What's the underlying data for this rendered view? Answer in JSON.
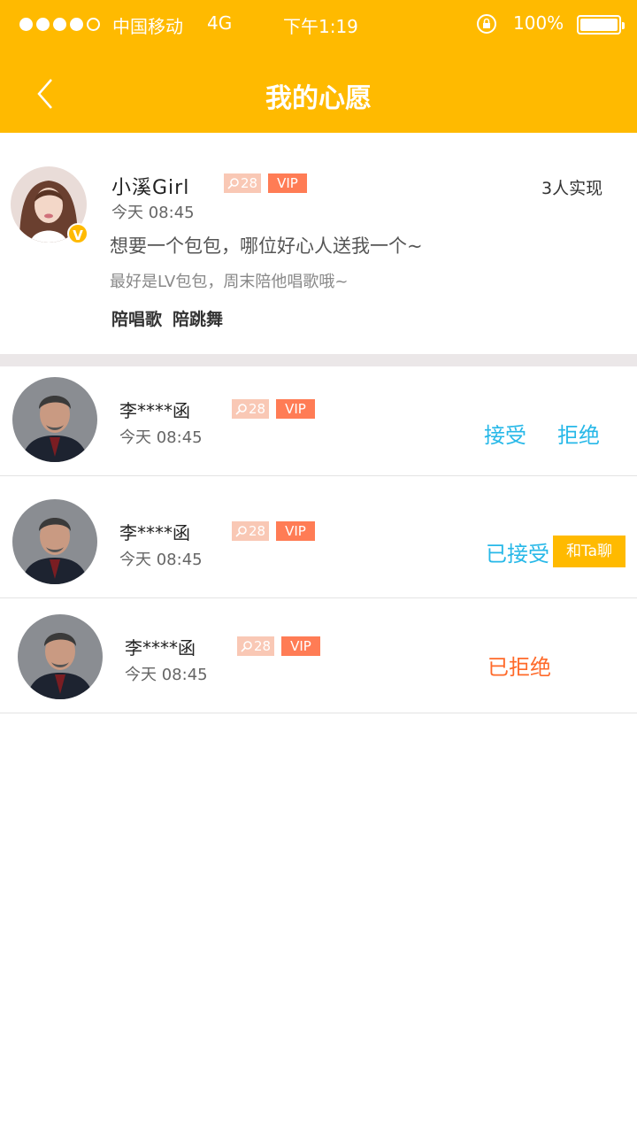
{
  "status_bar": {
    "carrier": "中国移动",
    "network": "4G",
    "time": "下午1:19",
    "battery": "100%"
  },
  "nav": {
    "title": "我的心愿"
  },
  "wish": {
    "user_name": "小溪Girl",
    "age": "28",
    "vip": "VIP",
    "verified_badge": "V",
    "time": "今天 08:45",
    "fulfilled": "3人实现",
    "text": "想要一个包包，哪位好心人送我一个~",
    "detail": "最好是LV包包，周末陪他唱歌哦~",
    "tags": [
      "陪唱歌",
      "陪跳舞"
    ]
  },
  "responses": [
    {
      "name": "李****函",
      "age": "28",
      "vip": "VIP",
      "time": "今天 08:45",
      "accept": "接受",
      "reject": "拒绝"
    },
    {
      "name": "李****函",
      "age": "28",
      "vip": "VIP",
      "time": "今天 08:45",
      "status": "已接受",
      "chat": "和Ta聊"
    },
    {
      "name": "李****函",
      "age": "28",
      "vip": "VIP",
      "time": "今天 08:45",
      "status": "已拒绝"
    }
  ],
  "colors": {
    "header": "#ffba00",
    "accept": "#27b8e8",
    "refused": "#ff6a2a",
    "vip": "#ff7c55",
    "age_badge": "#f9c8b5"
  }
}
